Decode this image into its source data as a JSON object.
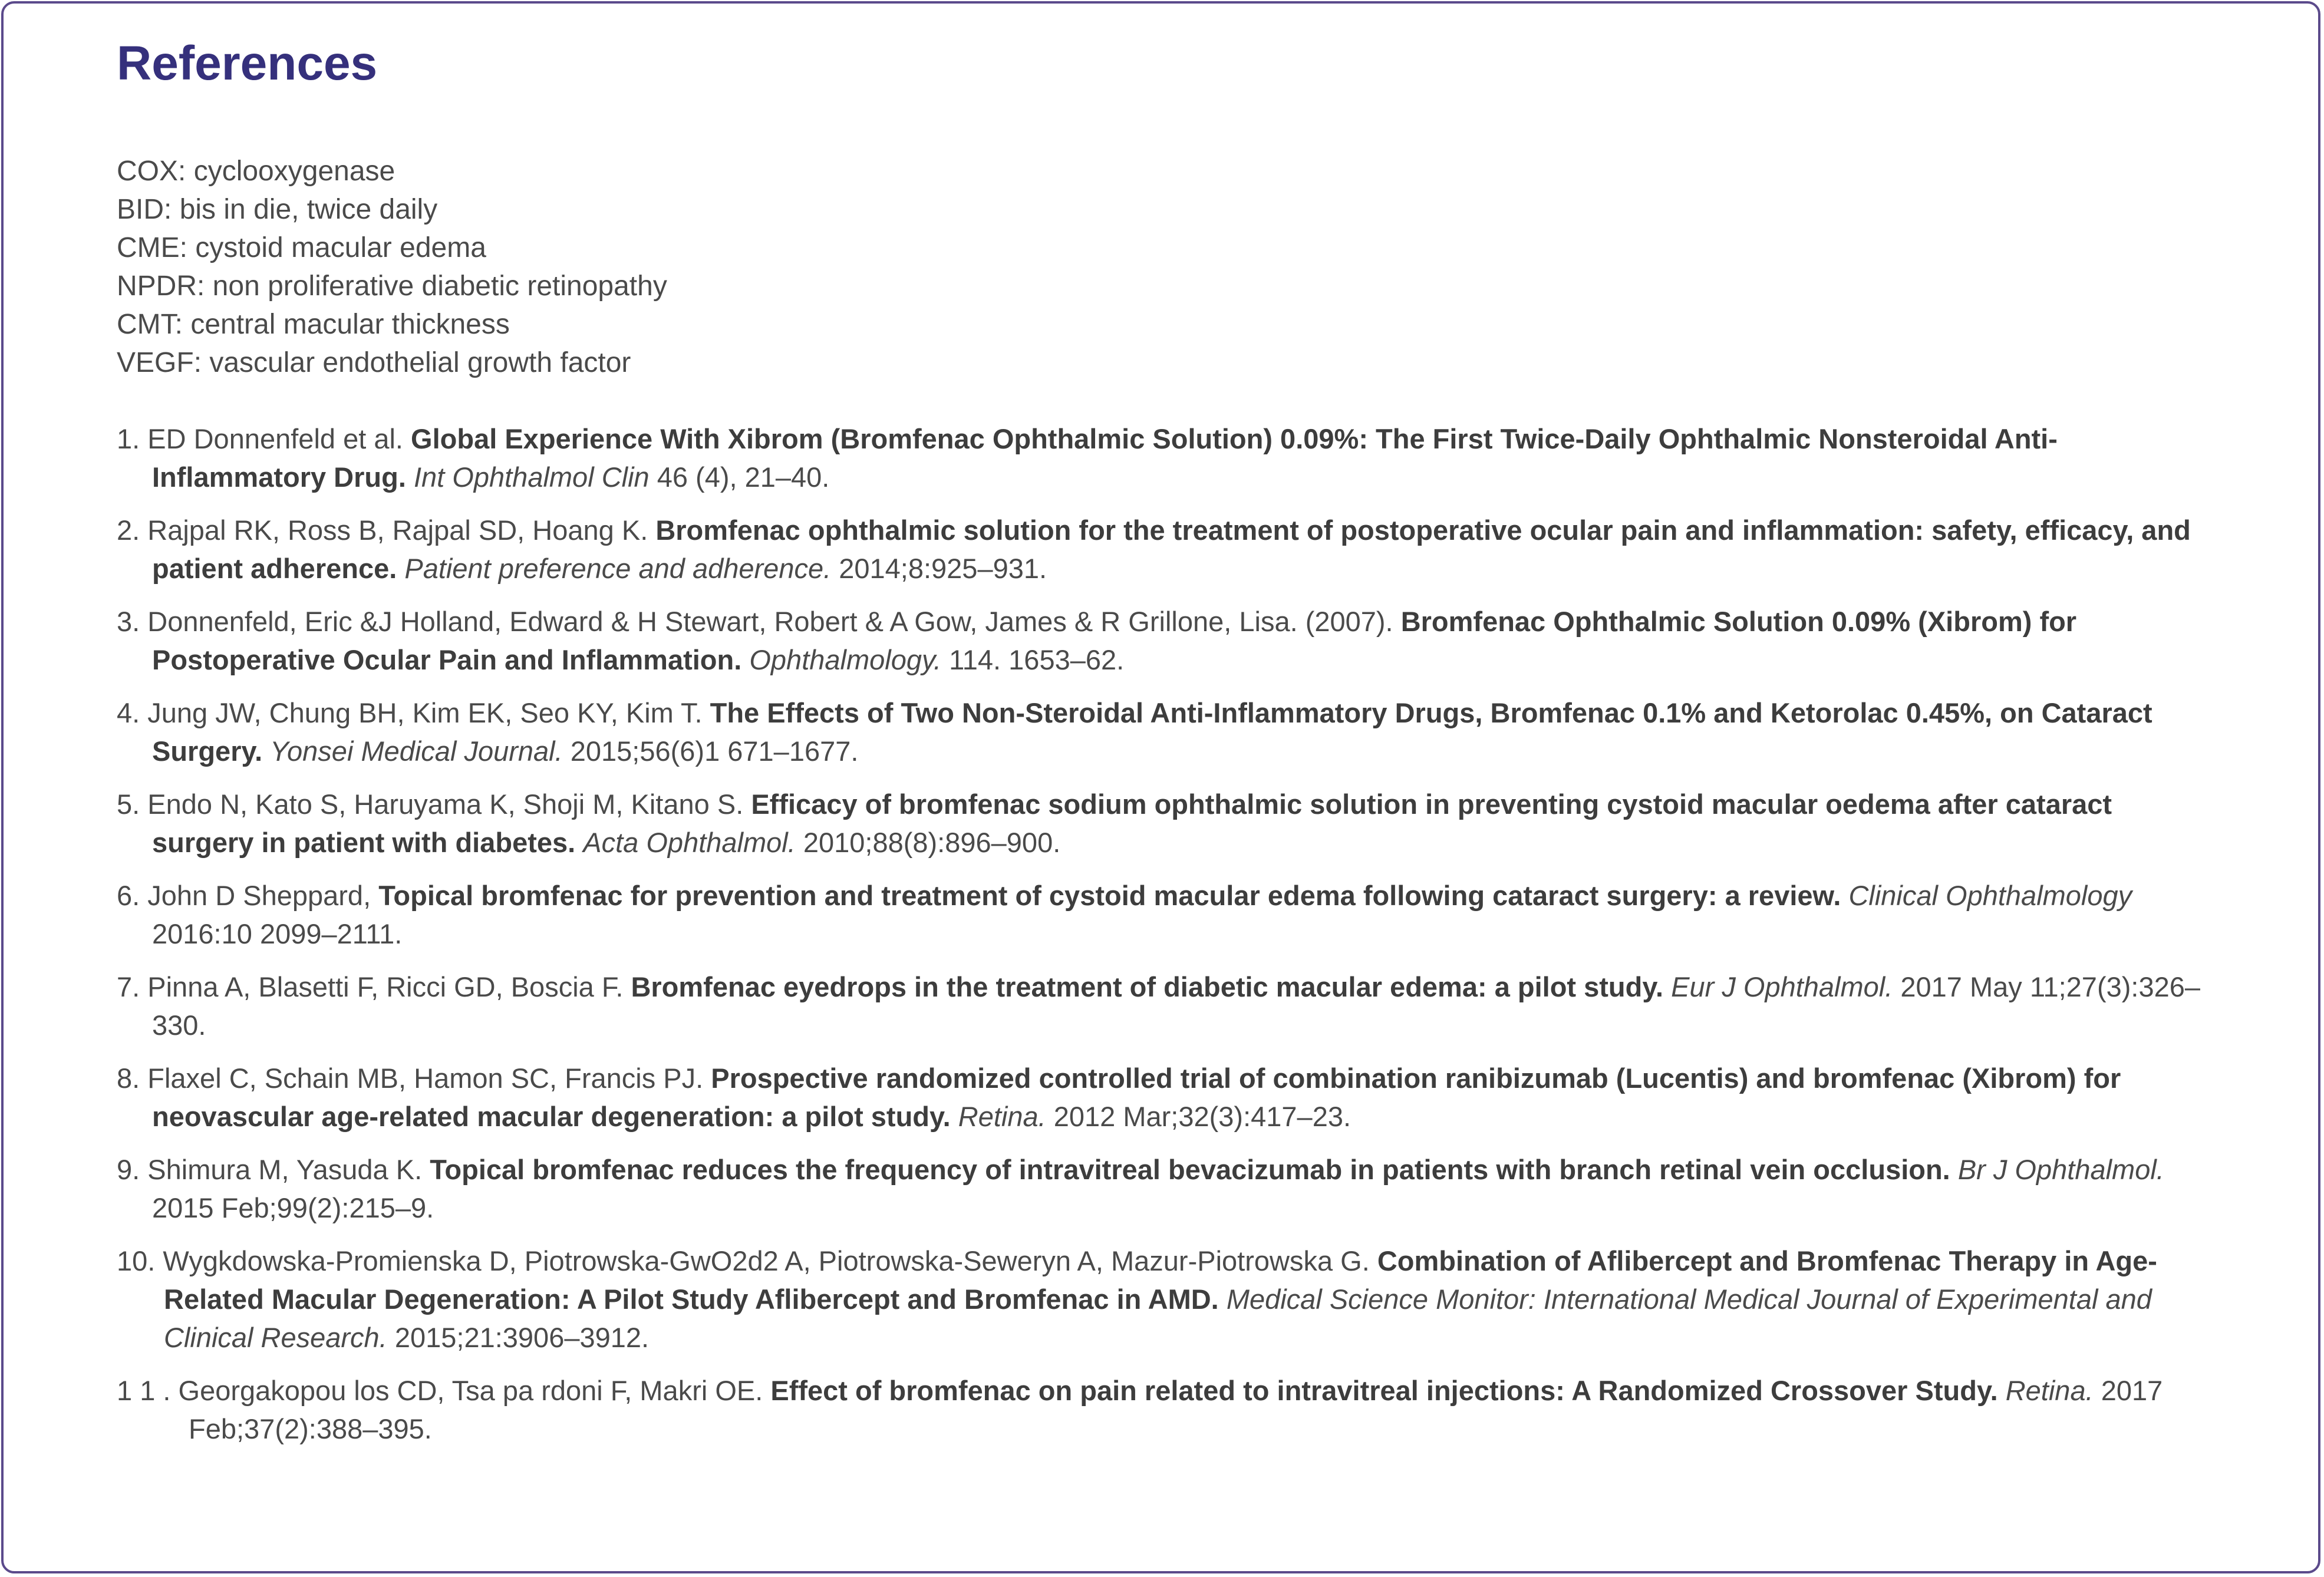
{
  "title": "References",
  "abbreviations": [
    "COX: cyclooxygenase",
    "BID: bis in die, twice daily",
    "CME: cystoid macular edema",
    "NPDR: non proliferative diabetic retinopathy",
    "CMT: central macular thickness",
    "VEGF: vascular endothelial growth factor"
  ],
  "references": [
    {
      "num": "1.",
      "authors": "ED Donnenfeld et al.",
      "title": "Global Experience With Xibrom (Bromfenac Ophthalmic Solution) 0.09%: The First Twice-Daily Ophthalmic Nonsteroidal Anti-Inflammatory Drug.",
      "journal": "Int Ophthalmol Clin",
      "details": "46 (4), 21–40."
    },
    {
      "num": "2.",
      "authors": "Rajpal RK, Ross B, Rajpal SD, Hoang K.",
      "title": "Bromfenac ophthalmic solution for the treatment of postoperative ocular pain and inflammation: safety, efficacy, and patient adherence.",
      "journal": "Patient preference and adherence.",
      "details": "2014;8:925–931."
    },
    {
      "num": "3.",
      "authors": "Donnenfeld, Eric &J Holland, Edward & H Stewart, Robert & A Gow, James & R Grillone, Lisa. (2007).",
      "title": "Bromfenac Ophthalmic Solution 0.09% (Xibrom) for Postoperative Ocular Pain and Inflammation.",
      "journal": "Ophthalmology.",
      "details": "114. 1653–62."
    },
    {
      "num": "4.",
      "authors": "Jung JW, Chung BH, Kim EK, Seo KY, Kim T.",
      "title": "The Effects of Two Non-Steroidal Anti-Inflammatory Drugs, Bromfenac 0.1% and Ketorolac 0.45%, on Cataract Surgery.",
      "journal": "Yonsei Medical Journal.",
      "details": "2015;56(6)1 671–1677."
    },
    {
      "num": "5.",
      "authors": "Endo N, Kato S, Haruyama K, Shoji M, Kitano S.",
      "title": "Efficacy of bromfenac sodium ophthalmic solution in preventing cystoid macular oedema after cataract surgery in patient with diabetes.",
      "journal": "Acta Ophthalmol.",
      "details": "2010;88(8):896–900."
    },
    {
      "num": "6.",
      "authors": "John D Sheppard,",
      "title": "Topical bromfenac for prevention and treatment of cystoid macular edema following cataract surgery: a review.",
      "journal": "Clinical Ophthalmology",
      "details": "2016:10 2099–2111."
    },
    {
      "num": "7.",
      "authors": "Pinna A, Blasetti F, Ricci GD, Boscia F.",
      "title": "Bromfenac eyedrops in the treatment of diabetic macular edema: a pilot study.",
      "journal": "Eur J Ophthalmol.",
      "details": "2017 May 11;27(3):326–330."
    },
    {
      "num": "8.",
      "authors": "Flaxel C, Schain MB, Hamon SC, Francis PJ.",
      "title": "Prospective randomized controlled trial of combination ranibizumab (Lucentis) and bromfenac (Xibrom) for neovascular age-related macular degeneration: a pilot study.",
      "journal": "Retina.",
      "details": "2012 Mar;32(3):417–23."
    },
    {
      "num": "9.",
      "authors": "Shimura M, Yasuda K.",
      "title": "Topical bromfenac reduces the frequency of intravitreal bevacizumab in patients with branch retinal vein occlusion.",
      "journal": "Br J Ophthalmol.",
      "details": "2015 Feb;99(2):215–9."
    },
    {
      "num": "10.",
      "authors": "Wygkdowska-Promienska D, Piotrowska-GwO2d2 A, Piotrowska-Seweryn A, Mazur-Piotrowska G.",
      "title": "Combination of Aflibercept and Bromfenac Therapy in Age-Related Macular Degeneration: A Pilot Study Aflibercept and Bromfenac in AMD.",
      "journal": "Medical Science Monitor: International Medical Journal of Experimental and Clinical Research.",
      "details": "2015;21:3906–3912."
    },
    {
      "num": "1 1 .",
      "authors": "Georgakopou los CD, Tsa pa rdoni F, Makri OE.",
      "title": "Effect of bromfenac on pain related to intravitreal injections: A Randomized Crossover Study.",
      "journal": "Retina.",
      "details": "2017 Feb;37(2):388–395."
    }
  ]
}
